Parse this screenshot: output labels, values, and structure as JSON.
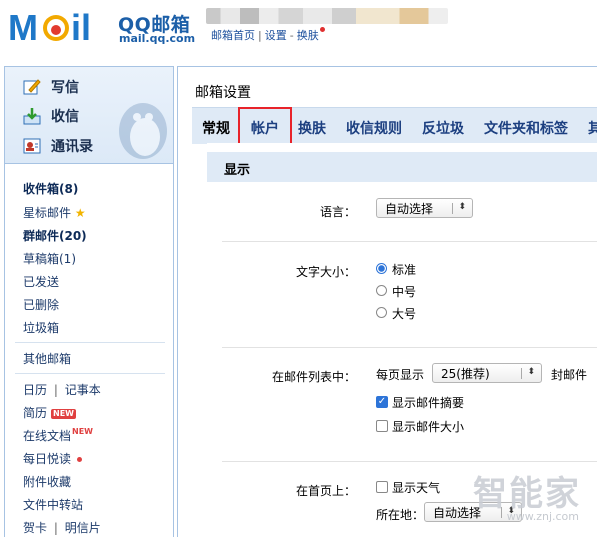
{
  "header": {
    "brand": "QQ邮箱",
    "brand_url": "mail.qq.com",
    "links": [
      "邮箱首页",
      "设置",
      "换肤"
    ],
    "separators": [
      "|",
      "-"
    ]
  },
  "left": {
    "actions": [
      "写信",
      "收信",
      "通讯录"
    ],
    "folders": [
      {
        "label": "收件箱(8)",
        "bold": true
      },
      {
        "label": "星标邮件",
        "bold": false
      },
      {
        "label": "群邮件(20)",
        "bold": true
      },
      {
        "label": "草稿箱(1)",
        "bold": false
      },
      {
        "label": "已发送",
        "bold": false
      },
      {
        "label": "已删除",
        "bold": false
      },
      {
        "label": "垃圾箱",
        "bold": false
      }
    ],
    "other_mailbox": "其他邮箱",
    "apps": {
      "calendar": "日历",
      "sep": "|",
      "notes": "记事本",
      "resume": "简历",
      "new_badge": "NEW",
      "docs": "在线文档",
      "daily": "每日悦读",
      "attachments": "附件收藏",
      "transfer": "文件中转站",
      "card": "贺卡",
      "postcard": "明信片"
    }
  },
  "right": {
    "title": "邮箱设置",
    "tabs": [
      "常规",
      "帐户",
      "换肤",
      "收信规则",
      "反垃圾",
      "文件夹和标签",
      "其"
    ],
    "active_tab_index": 0,
    "highlighted_tab_index": 1,
    "section": "显示",
    "language": {
      "label": "语言：",
      "value": "自动选择"
    },
    "font_size": {
      "label": "文字大小：",
      "options": [
        "标准",
        "中号",
        "大号"
      ],
      "selected": 0
    },
    "list": {
      "label": "在邮件列表中：",
      "prefix": "每页显示",
      "value": "25(推荐)",
      "suffix": "封邮件",
      "show_summary": "显示邮件摘要",
      "show_summary_checked": true,
      "show_size": "显示邮件大小",
      "show_size_checked": false
    },
    "home": {
      "label": "在首页上：",
      "show_weather": "显示天气",
      "show_weather_checked": false,
      "location_label": "所在地：",
      "location_value": "自动选择"
    }
  },
  "watermark": {
    "text": "智能家",
    "url": "www.znj.com"
  },
  "colors": {
    "link": "#1c4f9c",
    "panel_border": "#a7c3e3",
    "tab_bg": "#dfeaf6",
    "highlight": "#e8232a",
    "accent": "#2d74d8"
  }
}
